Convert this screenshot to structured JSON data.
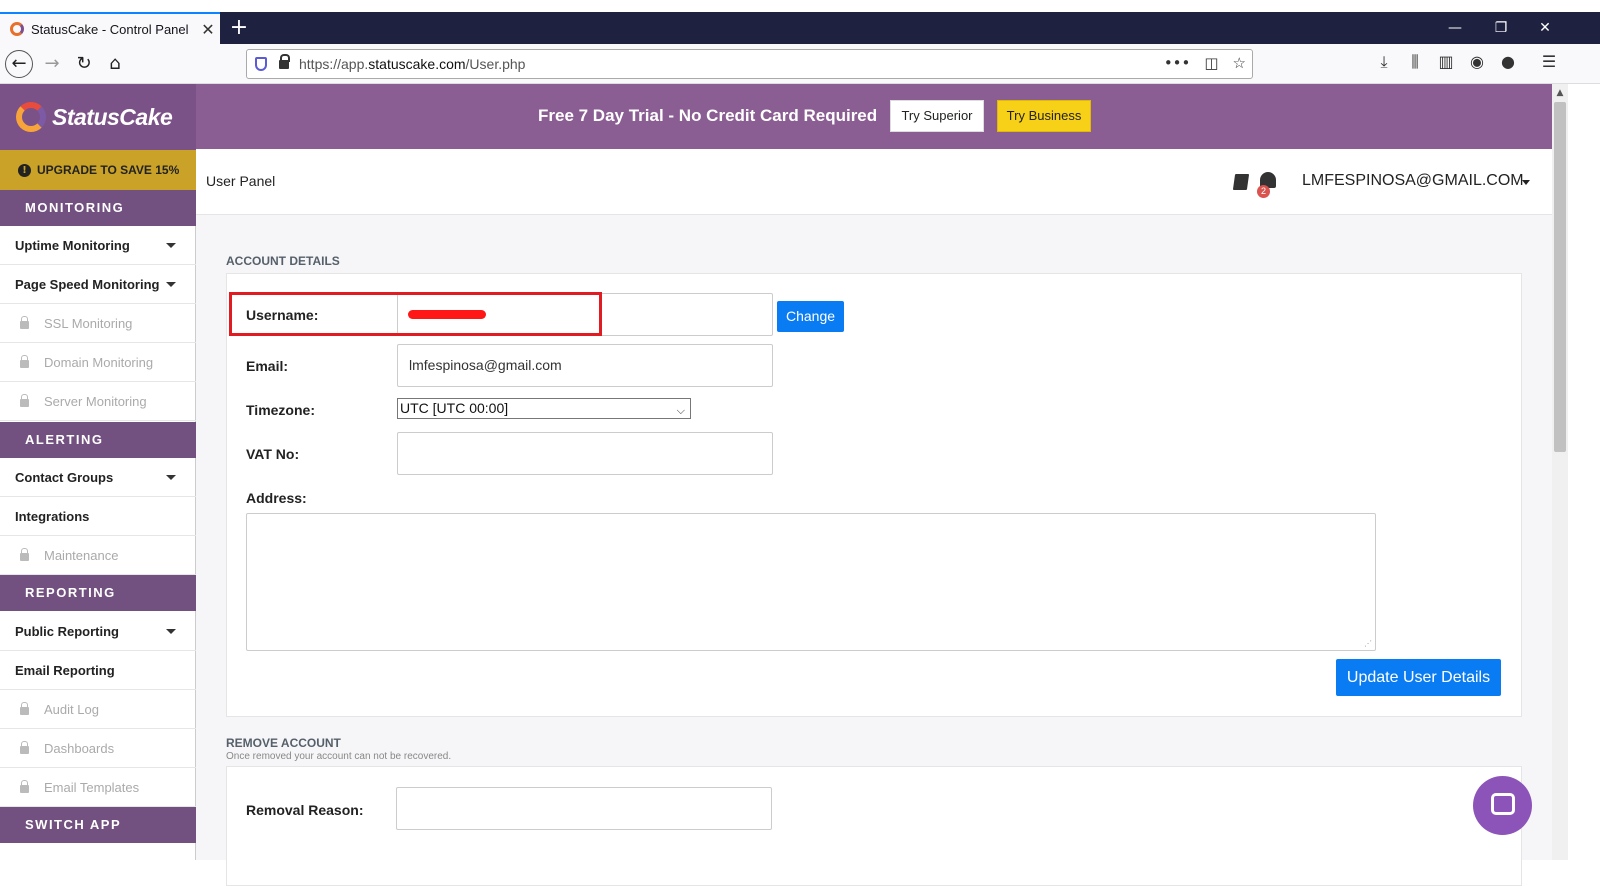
{
  "browser": {
    "tab_title": "StatusCake - Control Panel",
    "url_prefix": "https://app.",
    "url_domain": "statuscake.com",
    "url_path": "/User.php"
  },
  "sidebar": {
    "logo_text": "StatusCake",
    "upgrade_label": "UPGRADE TO SAVE 15%",
    "sections": {
      "monitoring": "MONITORING",
      "alerting": "ALERTING",
      "reporting": "REPORTING",
      "switch_app": "SWITCH APP"
    },
    "items": {
      "uptime": "Uptime Monitoring",
      "pagespeed": "Page Speed Monitoring",
      "ssl": "SSL Monitoring",
      "domain": "Domain Monitoring",
      "server": "Server Monitoring",
      "contact_groups": "Contact Groups",
      "integrations": "Integrations",
      "maintenance": "Maintenance",
      "public_reporting": "Public Reporting",
      "email_reporting": "Email Reporting",
      "audit_log": "Audit Log",
      "dashboards": "Dashboards",
      "email_templates": "Email Templates"
    }
  },
  "banner": {
    "text": "Free 7 Day Trial - No Credit Card Required",
    "try_superior": "Try Superior",
    "try_business": "Try Business"
  },
  "header": {
    "panel_title": "User Panel",
    "notification_count": "2",
    "user_email": "LMFESPINOSA@GMAIL.COM"
  },
  "account": {
    "section_title": "ACCOUNT DETAILS",
    "username_label": "Username:",
    "change_button": "Change",
    "email_label": "Email:",
    "email_value": "lmfespinosa@gmail.com",
    "timezone_label": "Timezone:",
    "timezone_value": "UTC [UTC 00:00]",
    "vat_label": "VAT No:",
    "address_label": "Address:",
    "update_button": "Update User Details"
  },
  "remove": {
    "section_title": "REMOVE ACCOUNT",
    "subtitle": "Once removed your account can not be recovered.",
    "reason_label": "Removal Reason:"
  },
  "colors": {
    "brand_purple": "#7b5287",
    "banner_purple": "#8a5e92",
    "upgrade_gold": "#c9a227",
    "primary_blue": "#0a7cf3",
    "business_yellow": "#f7d117",
    "highlight_red": "#e11b22"
  }
}
